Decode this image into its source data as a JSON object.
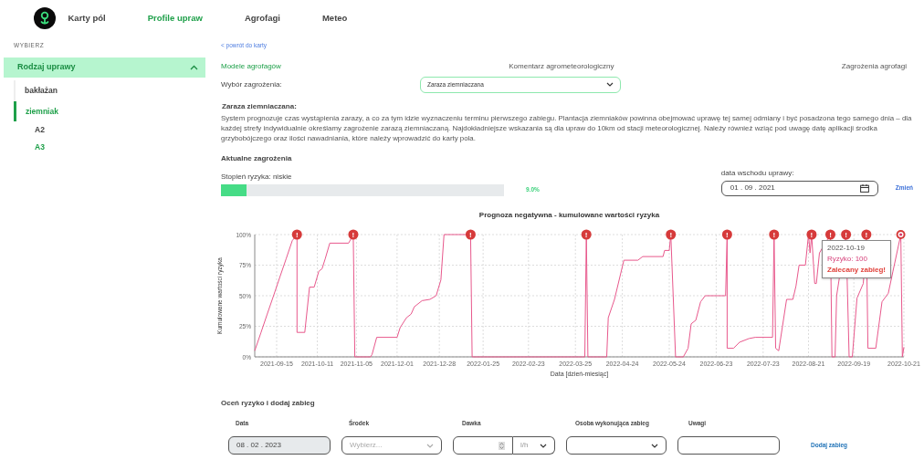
{
  "nav": {
    "items": [
      {
        "label": "Karty pól",
        "selected": false
      },
      {
        "label": "Profile upraw",
        "selected": true
      },
      {
        "label": "Agrofagi",
        "selected": false
      },
      {
        "label": "Meteo",
        "selected": false
      }
    ]
  },
  "sidebar": {
    "caption": "WYBIERZ",
    "section": {
      "title": "Rodzaj uprawy",
      "expanded": true
    },
    "items": [
      {
        "label": "bakłażan",
        "selected": false
      },
      {
        "label": "ziemniak",
        "selected": true,
        "children": [
          {
            "label": "A2",
            "selected": false
          },
          {
            "label": "A3",
            "selected": true
          }
        ]
      }
    ]
  },
  "back_link": "< powrót do karty",
  "tabs": [
    {
      "label": "Modele agrofagów",
      "selected": true
    },
    {
      "label": "Komentarz agrometeorologiczny",
      "selected": false
    },
    {
      "label": "Zagrożenia agrofagi",
      "selected": false
    }
  ],
  "threat_select": {
    "label": "Wybór zagrożenia:",
    "value": "Zaraza ziemniaczana"
  },
  "description": {
    "title": "Zaraza ziemniaczana:",
    "text": "System prognozuje czas wystąpienia zarazy, a co za tym idzie wyznaczeniu terminu pierwszego zabiegu. Plantacja ziemniaków powinna obejmować uprawę tej samej odmiany i być posadzona tego samego dnia – dla każdej strefy indywidualnie określamy zagrożenie zarazą ziemniaczaną. Najdokładniejsze wskazania są dla upraw do 10km od stacji meteorologicznej. Należy również wziąć pod uwagę datę aplikacji środka grzybobójczego oraz ilości nawadniania, które należy wprowadzić do karty pola."
  },
  "current": {
    "title": "Aktualne zagrożenia",
    "risk_label": "Stopień ryzyka: niskie",
    "level": 0.09,
    "reading": "9.0%",
    "date_label": "data wschodu uprawy:",
    "date_value": "01 . 09 . 2021",
    "change": "Zmień"
  },
  "chart": {
    "chart_data": {
      "type": "line",
      "title": "Prognoza negatywna - kumulowane wartości ryzyka",
      "xlabel": "Data [dzień-miesiąc]",
      "ylabel": "Kumulowane wartości ryzyka",
      "xlim": [
        "2021-09-01",
        "2022-10-21"
      ],
      "ylim": [
        0,
        100
      ],
      "grid": true,
      "xticks": [
        "2021-09-15",
        "2021-10-11",
        "2021-11-05",
        "2021-12-01",
        "2021-12-28",
        "2022-01-25",
        "2022-02-23",
        "2022-03-25",
        "2022-04-24",
        "2022-05-24",
        "2022-06-23",
        "2022-07-23",
        "2022-08-21",
        "2022-09-19",
        "2022-10-21"
      ],
      "yticks": [
        {
          "value": 0,
          "label": "0%"
        },
        {
          "value": 25,
          "label": "25%"
        },
        {
          "value": 50,
          "label": "50%"
        },
        {
          "value": 75,
          "label": "75%"
        },
        {
          "value": 100,
          "label": "100%"
        }
      ],
      "series": [
        {
          "color": "#e8588c",
          "x": [
            "2021-09-01",
            "2021-09-05",
            "2021-09-09",
            "2021-09-13",
            "2021-09-17",
            "2021-09-21",
            "2021-09-25",
            "2021-09-28",
            "2021-09-28",
            "2021-10-03",
            "2021-10-06",
            "2021-10-09",
            "2021-10-12",
            "2021-10-14",
            "2021-10-16",
            "2021-10-19",
            "2021-10-31",
            "2021-11-03",
            "2021-11-04",
            "2021-11-14",
            "2021-11-15",
            "2021-11-18",
            "2021-12-01",
            "2021-12-03",
            "2021-12-07",
            "2021-12-10",
            "2021-12-12",
            "2021-12-17",
            "2021-12-22",
            "2021-12-26",
            "2021-12-29",
            "2021-12-31",
            "2022-01-17",
            "2022-01-18",
            "2022-03-31",
            "2022-04-01",
            "2022-04-02",
            "2022-04-14",
            "2022-04-15",
            "2022-04-19",
            "2022-04-25",
            "2022-05-04",
            "2022-05-07",
            "2022-05-20",
            "2022-05-21",
            "2022-05-24",
            "2022-05-25",
            "2022-05-28",
            "2022-06-02",
            "2022-06-05",
            "2022-06-07",
            "2022-06-10",
            "2022-06-13",
            "2022-06-16",
            "2022-06-29",
            "2022-06-30",
            "2022-06-30",
            "2022-07-04",
            "2022-07-08",
            "2022-07-14",
            "2022-07-18",
            "2022-07-29",
            "2022-07-30",
            "2022-07-31",
            "2022-08-02",
            "2022-08-07",
            "2022-08-11",
            "2022-08-13",
            "2022-08-15",
            "2022-08-19",
            "2022-08-21",
            "2022-08-22",
            "2022-08-23",
            "2022-08-25",
            "2022-08-26",
            "2022-08-28",
            "2022-09-03",
            "2022-09-04",
            "2022-09-05",
            "2022-09-07",
            "2022-09-08",
            "2022-09-10",
            "2022-09-14",
            "2022-09-16",
            "2022-09-18",
            "2022-09-21",
            "2022-09-25",
            "2022-09-27",
            "2022-09-28",
            "2022-10-03",
            "2022-10-07",
            "2022-10-11",
            "2022-10-14",
            "2022-10-19",
            "2022-10-20",
            "2022-10-21"
          ],
          "values": [
            5,
            20,
            35,
            50,
            65,
            80,
            95,
            100,
            20,
            20,
            57,
            57,
            70,
            72,
            80,
            93,
            93,
            100,
            0,
            0,
            2,
            16,
            16,
            24,
            32,
            35,
            41,
            46,
            47,
            50,
            63,
            100,
            100,
            0,
            0,
            100,
            0,
            0,
            32,
            47,
            79,
            79,
            82,
            82,
            87,
            87,
            100,
            0,
            0,
            7,
            27,
            30,
            45,
            50,
            50,
            100,
            7,
            7,
            12,
            15,
            16,
            16,
            100,
            7,
            5,
            47,
            47,
            58,
            75,
            75,
            100,
            85,
            100,
            60,
            60,
            85,
            null,
            100,
            0,
            0,
            50,
            null,
            100,
            0,
            0,
            48,
            60,
            100,
            7,
            7,
            45,
            52,
            70,
            100,
            0,
            8
          ]
        }
      ],
      "annotations": [
        {
          "x": "2021-09-28",
          "y": 100,
          "text": "!"
        },
        {
          "x": "2021-11-03",
          "y": 100,
          "text": "!"
        },
        {
          "x": "2022-01-17",
          "y": 100,
          "text": "!"
        },
        {
          "x": "2022-04-01",
          "y": 100,
          "text": "!"
        },
        {
          "x": "2022-05-25",
          "y": 100,
          "text": "!"
        },
        {
          "x": "2022-06-30",
          "y": 100,
          "text": "!"
        },
        {
          "x": "2022-07-30",
          "y": 100,
          "text": "!"
        },
        {
          "x": "2022-08-23",
          "y": 100,
          "text": "!"
        },
        {
          "x": "2022-09-04",
          "y": 100,
          "text": "!"
        },
        {
          "x": "2022-09-14",
          "y": 100,
          "text": "!"
        },
        {
          "x": "2022-09-27",
          "y": 100,
          "text": "!"
        }
      ]
    },
    "tooltip": {
      "date": "2022-10-19",
      "risk": "Ryzyko: 100",
      "advice": "Zalecany zabieg!"
    }
  },
  "form": {
    "title": "Oceń ryzyko i dodaj zabieg",
    "columns": [
      "Data",
      "Środek",
      "Dawka",
      "Osoba wykonująca zabieg",
      "Uwagi"
    ],
    "date_value": "08 . 02 . 2023",
    "agent_placeholder": "Wybierz...",
    "unit": "l/h",
    "submit": "Dodaj zabieg"
  }
}
